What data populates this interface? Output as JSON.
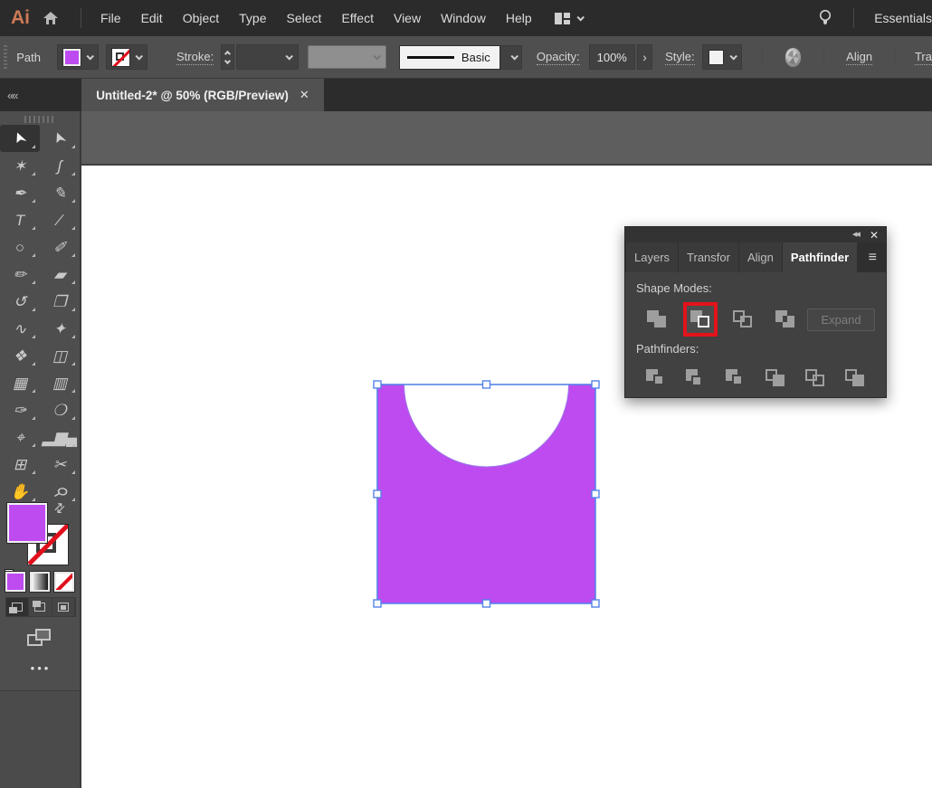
{
  "app": {
    "logo": "Ai",
    "workspace": "Essentials"
  },
  "menus": [
    {
      "id": "file",
      "label": "File"
    },
    {
      "id": "edit",
      "label": "Edit"
    },
    {
      "id": "object",
      "label": "Object"
    },
    {
      "id": "type",
      "label": "Type"
    },
    {
      "id": "select",
      "label": "Select"
    },
    {
      "id": "effect",
      "label": "Effect"
    },
    {
      "id": "view",
      "label": "View"
    },
    {
      "id": "window",
      "label": "Window"
    },
    {
      "id": "help",
      "label": "Help"
    }
  ],
  "control": {
    "selection_type": "Path",
    "stroke_label": "Stroke:",
    "brush_name": "Basic",
    "opacity_label": "Opacity:",
    "opacity_value": "100%",
    "more_glyph": "›",
    "style_label": "Style:",
    "align_label": "Align",
    "transform_label": "Tra",
    "fill_color": "#be4bef"
  },
  "doc_tab": {
    "title": "Untitled-2* @ 50% (RGB/Preview)",
    "close_glyph": "✕"
  },
  "tools": [
    {
      "id": "selection",
      "glyph": "➤",
      "cls": "active",
      "gcls": "rot-nw"
    },
    {
      "id": "direct-selection",
      "glyph": "➤",
      "cls": "filled",
      "gcls": "rot-nw"
    },
    {
      "id": "magic-wand",
      "glyph": "✶",
      "cls": "",
      "gcls": ""
    },
    {
      "id": "lasso",
      "glyph": "ʃ",
      "cls": "",
      "gcls": ""
    },
    {
      "id": "pen",
      "glyph": "✒",
      "cls": "",
      "gcls": ""
    },
    {
      "id": "curvature",
      "glyph": "✎",
      "cls": "",
      "gcls": ""
    },
    {
      "id": "type",
      "glyph": "T",
      "cls": "",
      "gcls": ""
    },
    {
      "id": "line-segment",
      "glyph": "∕",
      "cls": "",
      "gcls": ""
    },
    {
      "id": "ellipse",
      "glyph": "○",
      "cls": "",
      "gcls": ""
    },
    {
      "id": "paintbrush",
      "glyph": "✐",
      "cls": "",
      "gcls": ""
    },
    {
      "id": "shaper",
      "glyph": "✏",
      "cls": "",
      "gcls": ""
    },
    {
      "id": "eraser",
      "glyph": "▰",
      "cls": "",
      "gcls": ""
    },
    {
      "id": "rotate",
      "glyph": "↺",
      "cls": "",
      "gcls": ""
    },
    {
      "id": "scale",
      "glyph": "❐",
      "cls": "",
      "gcls": ""
    },
    {
      "id": "width",
      "glyph": "∿",
      "cls": "",
      "gcls": ""
    },
    {
      "id": "puppet-warp",
      "glyph": "✦",
      "cls": "",
      "gcls": ""
    },
    {
      "id": "shape-builder",
      "glyph": "❖",
      "cls": "",
      "gcls": ""
    },
    {
      "id": "perspective-grid",
      "glyph": "◫",
      "cls": "",
      "gcls": ""
    },
    {
      "id": "mesh",
      "glyph": "▦",
      "cls": "",
      "gcls": ""
    },
    {
      "id": "gradient",
      "glyph": "▥",
      "cls": "",
      "gcls": ""
    },
    {
      "id": "eyedropper",
      "glyph": "✑",
      "cls": "",
      "gcls": ""
    },
    {
      "id": "blend",
      "glyph": "❍",
      "cls": "",
      "gcls": ""
    },
    {
      "id": "symbol-sprayer",
      "glyph": "⌖",
      "cls": "",
      "gcls": ""
    },
    {
      "id": "column-graph",
      "glyph": "▂▆▄",
      "cls": "",
      "gcls": ""
    },
    {
      "id": "artboard",
      "glyph": "⊞",
      "cls": "",
      "gcls": ""
    },
    {
      "id": "slice",
      "glyph": "✂",
      "cls": "",
      "gcls": ""
    },
    {
      "id": "hand",
      "glyph": "✋",
      "cls": "",
      "gcls": ""
    },
    {
      "id": "zoom",
      "glyph": "⚲",
      "cls": "",
      "gcls": "rot45"
    }
  ],
  "panel": {
    "collapse_glyph": "◂◂",
    "close_glyph": "✕",
    "menu_glyph": "≡",
    "tabs": [
      {
        "id": "layers",
        "label": "Layers",
        "cls": ""
      },
      {
        "id": "transform",
        "label": "Transfor",
        "cls": ""
      },
      {
        "id": "align",
        "label": "Align",
        "cls": ""
      },
      {
        "id": "pathfinder",
        "label": "Pathfinder",
        "cls": "active"
      }
    ],
    "shape_modes_label": "Shape Modes:",
    "shape_modes": [
      {
        "id": "unite",
        "cls": "sm-unite",
        "slot": ""
      },
      {
        "id": "minus-front",
        "cls": "sm-minus-front",
        "slot": "highlighted"
      },
      {
        "id": "intersect",
        "cls": "sm-intersect",
        "slot": ""
      },
      {
        "id": "exclude",
        "cls": "sm-exclude",
        "slot": ""
      }
    ],
    "expand_label": "Expand",
    "pathfinders_label": "Pathfinders:",
    "pathfinders": [
      {
        "id": "divide",
        "cls": "pf-divide"
      },
      {
        "id": "trim",
        "cls": "pf-trim"
      },
      {
        "id": "merge",
        "cls": "pf-merge"
      },
      {
        "id": "crop",
        "cls": "pf-crop"
      },
      {
        "id": "outline",
        "cls": "pf-outline"
      },
      {
        "id": "minus-back",
        "cls": "pf-minus-back"
      }
    ],
    "highlight_color": "#e3131b"
  },
  "canvas": {
    "shape_fill": "#be4bef",
    "selection_color": "#5583e8"
  }
}
